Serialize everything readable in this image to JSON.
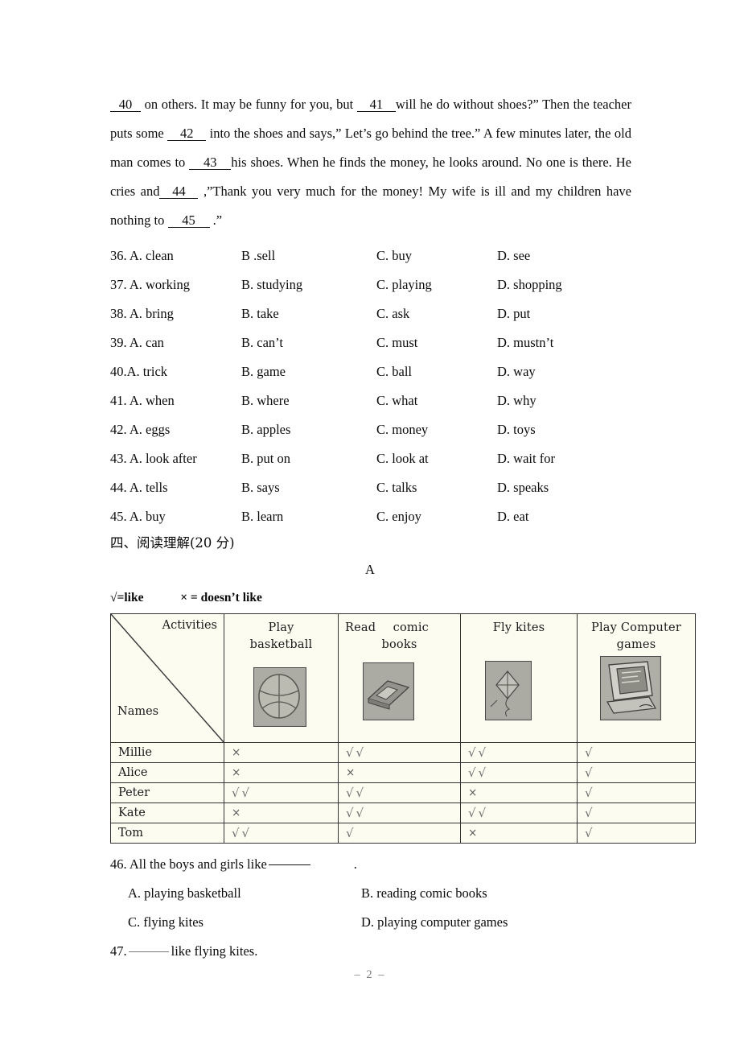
{
  "passage": {
    "segments": [
      {
        "t": "blank",
        "v": "40",
        "cls": "bl-40"
      },
      {
        "t": "text",
        "v": " on others. It may be funny for you, but "
      },
      {
        "t": "blank",
        "v": "41",
        "cls": "bl-41"
      },
      {
        "t": "text",
        "v": "will he do without shoes?” Then the teacher puts some "
      },
      {
        "t": "blank",
        "v": "42",
        "cls": "bl-42"
      },
      {
        "t": "text",
        "v": " into the shoes and says,” Let’s go behind the tree.” A few minutes later, the old man comes to "
      },
      {
        "t": "blank",
        "v": "43",
        "cls": "bl-43"
      },
      {
        "t": "text",
        "v": "his shoes. When he finds the money, he looks around. No one is there. He cries and"
      },
      {
        "t": "blank",
        "v": "44",
        "cls": "bl-44"
      },
      {
        "t": "text",
        "v": " ,”Thank you very much for the money! My wife is ill and my children have nothing to "
      },
      {
        "t": "blank",
        "v": "45",
        "cls": "bl-45"
      },
      {
        "t": "text",
        "v": " .”"
      }
    ]
  },
  "cloze_options": [
    {
      "a": "36. A.  clean",
      "b": "B .sell",
      "c": "C. buy",
      "d": "D. see"
    },
    {
      "a": "37. A. working",
      "b": "B. studying",
      "c": "C. playing",
      "d": "D. shopping"
    },
    {
      "a": "38. A. bring",
      "b": "B. take",
      "c": "C. ask",
      "d": "D. put"
    },
    {
      "a": "39. A. can",
      "b": "B. can’t",
      "c": "C. must",
      "d": "D. mustn’t"
    },
    {
      "a": "40.A. trick",
      "b": "B. game",
      "c": "C. ball",
      "d": "D. way"
    },
    {
      "a": "41. A. when",
      "b": "B. where",
      "c": "C. what",
      "d": "D. why"
    },
    {
      "a": "42. A. eggs",
      "b": "B. apples",
      "c": "C. money",
      "d": "D. toys"
    },
    {
      "a": "43. A. look after",
      "b": "B. put on",
      "c": "C. look at",
      "d": "D. wait for"
    },
    {
      "a": "44. A. tells",
      "b": "B. says",
      "c": "C. talks",
      "d": "D. speaks"
    },
    {
      "a": "45. A. buy",
      "b": "B. learn",
      "c": "C. enjoy",
      "d": "D. eat"
    }
  ],
  "section": {
    "heading": "四、阅读理解(20 分)",
    "part_label": "A",
    "legend_like": "√=like",
    "legend_dislike": "× = doesn’t like"
  },
  "table": {
    "corner_top": "Activities",
    "corner_bottom": "Names",
    "columns": [
      {
        "line1": "Play",
        "line2": "basketball",
        "icon": "basketball-icon",
        "spread": false
      },
      {
        "line1": "Read     comic",
        "line2": "books",
        "icon": "comic-book-icon",
        "spread": true
      },
      {
        "line1": "Fly kites",
        "line2": "",
        "icon": "kite-icon",
        "spread": false
      },
      {
        "line1": "Play Computer",
        "line2": "games",
        "icon": "computer-icon",
        "spread": false
      }
    ],
    "rows": [
      {
        "name": "Millie",
        "marks": [
          "×",
          "√√",
          "√√",
          "√"
        ]
      },
      {
        "name": "Alice",
        "marks": [
          "×",
          "×",
          "√√",
          "√"
        ]
      },
      {
        "name": "Peter",
        "marks": [
          "√√",
          "√√",
          "×",
          "√"
        ]
      },
      {
        "name": "Kate",
        "marks": [
          "×",
          "√√",
          "√√",
          "√"
        ]
      },
      {
        "name": "Tom",
        "marks": [
          "√√",
          "√",
          "×",
          "√"
        ]
      }
    ]
  },
  "questions": {
    "q46_pre": "46. All the boys and girls like",
    "q46_post": ".",
    "q46_a": "A. playing basketball",
    "q46_b": "B. reading comic books",
    "q46_c": "C. flying kites",
    "q46_d": "D. playing computer games",
    "q47_pre": "47.",
    "q47_post": "like flying kites."
  },
  "footer": "– 2 –"
}
